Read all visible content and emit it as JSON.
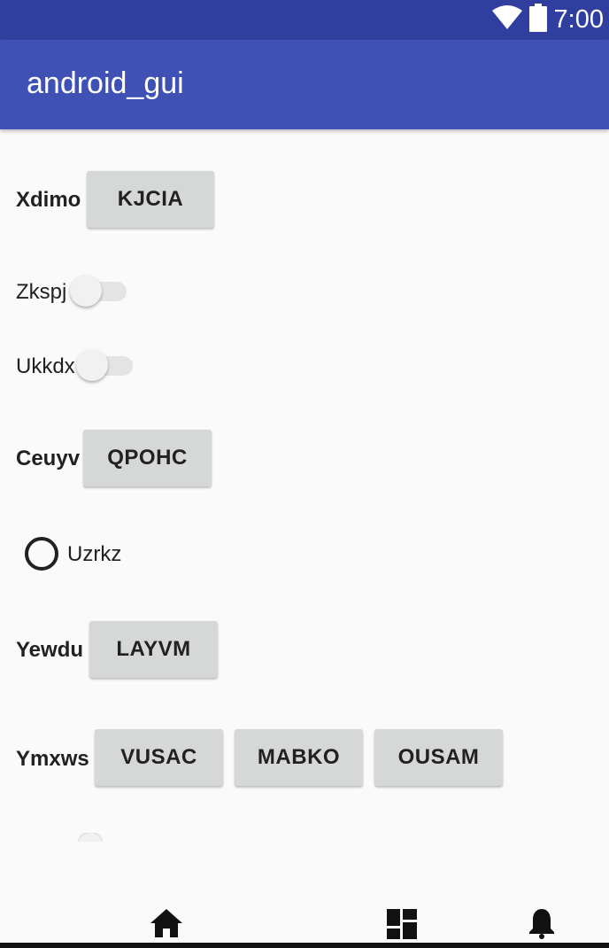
{
  "status_bar": {
    "time": "7:00",
    "icons": [
      "wifi-icon",
      "battery-icon"
    ],
    "color": "#303f9f"
  },
  "app_bar": {
    "title": "android_gui",
    "color": "#3f51b5"
  },
  "rows": {
    "row1": {
      "label": "Xdimo",
      "button": "KJCIA"
    },
    "row2": {
      "label": "Zkspj",
      "switch_on": false
    },
    "row3": {
      "label": "Ukkdx",
      "switch_on": false
    },
    "row4": {
      "label": "Ceuyv",
      "button": "QPOHC"
    },
    "row5": {
      "radio_label": "Uzrkz",
      "checked": false
    },
    "row6": {
      "label": "Yewdu",
      "button": "LAYVM"
    },
    "row7": {
      "label": "Ymxws",
      "buttons": [
        "VUSAC",
        "MABKO",
        "OUSAM"
      ]
    }
  },
  "bottom_nav": {
    "items": [
      "home-icon",
      "dashboard-icon",
      "notifications-icon"
    ]
  }
}
